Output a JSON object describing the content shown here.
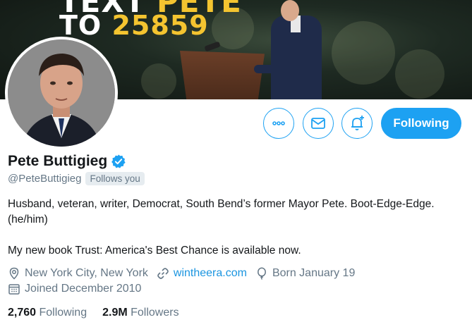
{
  "banner": {
    "line1_prefix": "TEXT ",
    "line1_highlight": "PETE",
    "line2_prefix": "TO ",
    "line2_highlight": "25859"
  },
  "actions": {
    "more_icon": "ellipsis-icon",
    "message_icon": "mail-icon",
    "notify_icon": "bell-plus-icon",
    "follow_label": "Following"
  },
  "profile": {
    "name": "Pete Buttigieg",
    "verified_icon": "verified-badge-icon",
    "handle": "@PeteButtigieg",
    "follows_you": "Follows you",
    "bio_line1": "Husband, veteran, writer, Democrat, South Bend’s former Mayor Pete. Boot-Edge-Edge. (he/him)",
    "bio_line2": "My new book Trust: America's Best Chance is available now.",
    "location": "New York City, New York",
    "website": "wintheera.com",
    "birthday": "Born January 19",
    "joined": "Joined December 2010"
  },
  "stats": {
    "following_count": "2,760",
    "following_label": "Following",
    "followers_count": "2.9M",
    "followers_label": "Followers"
  },
  "colors": {
    "accent": "#1da1f2",
    "banner_highlight": "#f4c430",
    "secondary_text": "#657786"
  }
}
